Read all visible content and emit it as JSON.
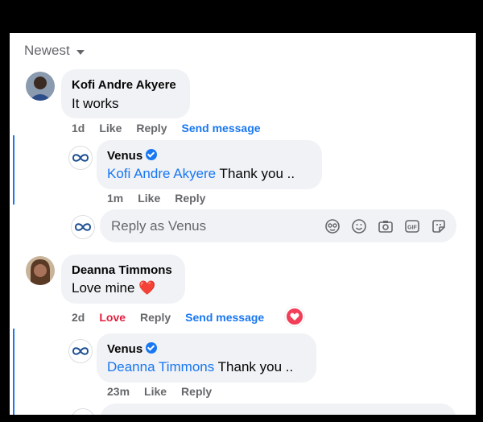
{
  "sort": {
    "label": "Newest"
  },
  "comments": [
    {
      "author": "Kofi Andre Akyere",
      "text": "It works",
      "age": "1d",
      "actions": [
        "Like",
        "Reply",
        "Send message"
      ],
      "reply": {
        "author": "Venus",
        "mention": "Kofi Andre Akyere",
        "text": " Thank you ..",
        "age": "1m",
        "actions": [
          "Like",
          "Reply"
        ]
      }
    },
    {
      "author": "Deanna Timmons",
      "text": "Love mine",
      "emoji": "❤️",
      "age": "2d",
      "actions": [
        "Love",
        "Reply",
        "Send message"
      ],
      "reply": {
        "author": "Venus",
        "mention": "Deanna Timmons",
        "text": " Thank you ..",
        "age": "23m",
        "actions": [
          "Like",
          "Reply"
        ]
      }
    }
  ],
  "reply_box": {
    "placeholder": "Reply as Venus"
  },
  "colors": {
    "accent": "#1877f2",
    "love": "#e41e3f",
    "bubble": "#f0f2f5"
  }
}
